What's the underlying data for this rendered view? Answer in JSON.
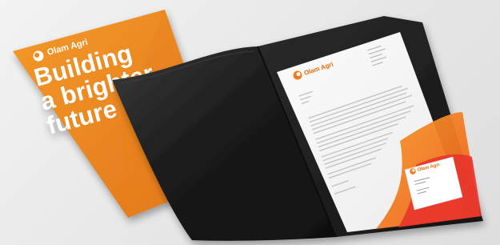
{
  "scene": {
    "description_colors": {
      "background": "#e8e8e8",
      "brochure_orange": "#f28a1a",
      "brochure_orange_dark": "#e06e12",
      "folder_black": "#1c1c1c",
      "letter_paper": "#f7f7f7",
      "accent_orange": "#f47b20",
      "accent_red": "#e8342c"
    }
  },
  "brochure": {
    "brand": "Olam Agri",
    "headline_lines": [
      "Building",
      "a brighter",
      "future"
    ],
    "logo_icon": "sun-leaf-icon"
  },
  "letterhead": {
    "brand": "Olam Agri",
    "logo_icon": "sun-leaf-icon"
  },
  "business_card": {
    "brand": "Olam Agri",
    "logo_icon": "sun-leaf-icon"
  }
}
